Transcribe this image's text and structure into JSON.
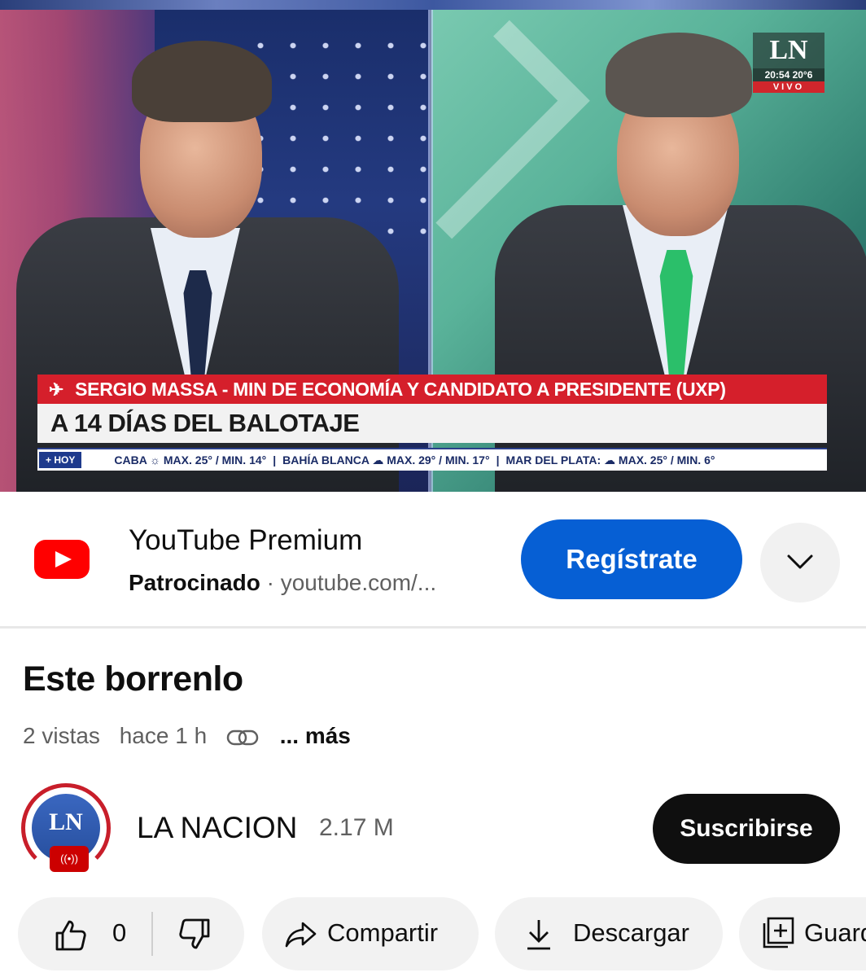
{
  "video": {
    "overlay": {
      "logo": "LN",
      "clock": "20:54 20°6",
      "live": "VIVO",
      "headline_top": "SERGIO MASSA - MIN DE ECONOMÍA Y CANDIDATO A PRESIDENTE (UXP)",
      "headline_main": "A 14 DÍAS DEL BALOTAJE",
      "ticker_tag": "+ HOY",
      "ticker_items": [
        "CABA ☼ MAX. 25° / MIN. 14°",
        "BAHÍA BLANCA ☁ MAX. 29° / MIN. 17°",
        "MAR DEL PLATA: ☁ MAX. 25° / MIN. 6°"
      ],
      "ticker_sep": "|"
    }
  },
  "ad": {
    "title": "YouTube Premium",
    "sponsored": "Patrocinado",
    "dot": "·",
    "url": "youtube.com/...",
    "cta": "Regístrate",
    "logo_icon": "youtube-logo-icon",
    "expand_icon": "chevron-down-icon",
    "brand_color": "#ff0000",
    "cta_color": "#065fd4"
  },
  "details": {
    "title": "Este borrenlo",
    "views": "2 vistas",
    "age": "hace 1 h",
    "more": "... más",
    "link_icon": "link-icon"
  },
  "channel": {
    "avatar_text": "LN",
    "live_icon": "((•))",
    "name": "LA NACION",
    "subscribers": "2.17 M",
    "subscribe": "Suscribirse"
  },
  "actions": {
    "likes": "0",
    "share": "Compartir",
    "download": "Descargar",
    "save": "Guardar"
  }
}
